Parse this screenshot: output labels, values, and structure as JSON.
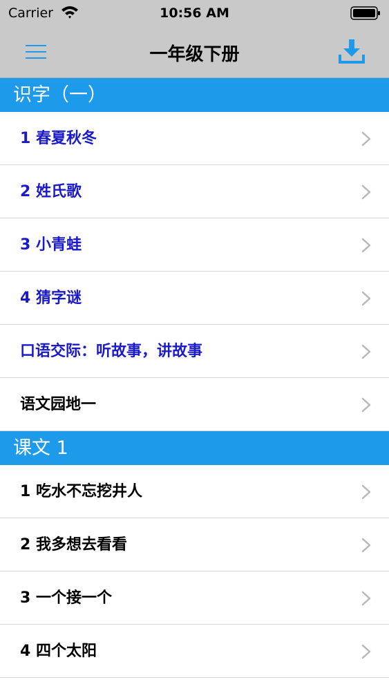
{
  "status_bar": {
    "carrier": "Carrier",
    "time": "10:56 AM"
  },
  "nav": {
    "title": "一年级下册",
    "menu_icon": "hamburger-menu-icon",
    "download_icon": "download-icon"
  },
  "colors": {
    "accent": "#1e9aea",
    "unit_text": "#1a1acc",
    "lesson_text": "#000000",
    "bar_bg": "#c9c9c9"
  },
  "sections": [
    {
      "title": "识字（一）",
      "items": [
        {
          "label": "1 春夏秋冬",
          "color": "#1a1acc"
        },
        {
          "label": "2 姓氏歌",
          "color": "#1a1acc"
        },
        {
          "label": "3 小青蛙",
          "color": "#1a1acc"
        },
        {
          "label": "4 猜字谜",
          "color": "#1a1acc"
        },
        {
          "label": "口语交际：听故事，讲故事",
          "color": "#1a1acc"
        },
        {
          "label": "语文园地一",
          "color": "#000000"
        }
      ]
    },
    {
      "title": "课文 1",
      "items": [
        {
          "label": "1 吃水不忘挖井人",
          "color": "#000000"
        },
        {
          "label": "2 我多想去看看",
          "color": "#000000"
        },
        {
          "label": "3 一个接一个",
          "color": "#000000"
        },
        {
          "label": "4 四个太阳",
          "color": "#000000"
        }
      ]
    }
  ]
}
